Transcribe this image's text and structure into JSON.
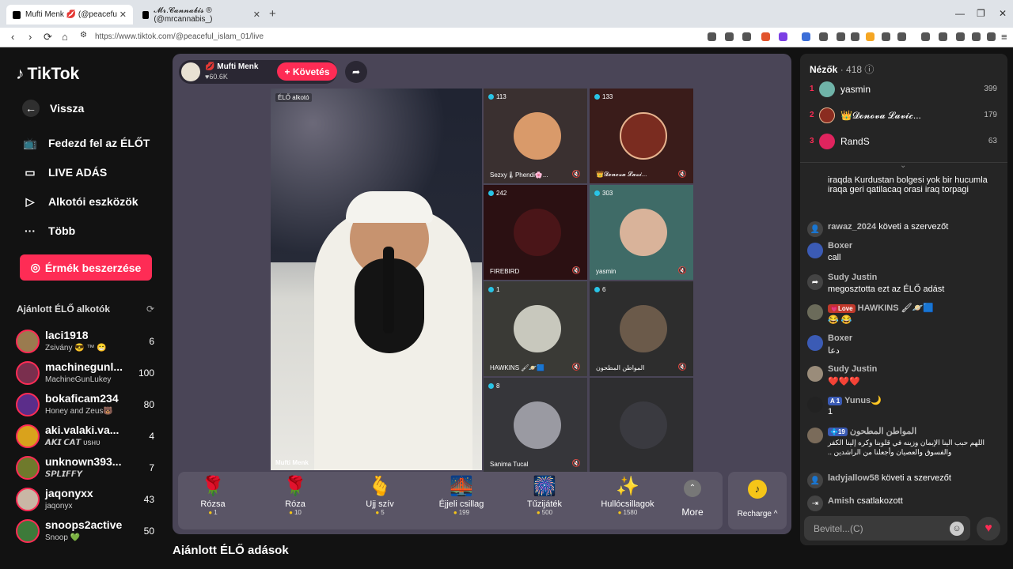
{
  "browser": {
    "tab1": "Mufti Menk 💋 (@peacefu",
    "tab2": "𝓜𝓻.𝓒𝓪𝓷𝓷𝓪𝓫𝓲𝓼 ® (@mrcannabis_)",
    "url": "https://www.tiktok.com/@peaceful_islam_01/live"
  },
  "sidebar": {
    "logo": "TikTok",
    "back": "Vissza",
    "nav": [
      "Fedezd fel az ÉLŐT",
      "LIVE ADÁS",
      "Alkotói eszközök",
      "Több"
    ],
    "coins_button": "Érmék beszerzése",
    "rec_title": "Ajánlott ÉLŐ alkotók",
    "creators": [
      {
        "name": "laci1918",
        "sub": "Zsivány 😎 ™ 😁",
        "count": "6"
      },
      {
        "name": "machinegunl...",
        "sub": "MachineGunLukey",
        "count": "100"
      },
      {
        "name": "bokaficam234",
        "sub": "Honey and Zeus🐻",
        "count": "80"
      },
      {
        "name": "aki.valaki.va...",
        "sub": "𝘼𝙆𝙄 𝘾𝘼𝙏 ᴜsʜᴜ",
        "count": "4"
      },
      {
        "name": "unknown393...",
        "sub": "𝙎𝙋𝙇𝙄𝙁𝙁𝙔",
        "count": "7"
      },
      {
        "name": "jaqonyxx",
        "sub": "jaqonyx",
        "count": "43"
      },
      {
        "name": "snoops2active",
        "sub": "Snoop 💚",
        "count": "50"
      }
    ]
  },
  "host": {
    "name": "Mufti Menk",
    "likes": "♥60.6K",
    "follow": "+ Követés",
    "elo_tag": "ÉLŐ alkotó",
    "foot": "Mufti Menk"
  },
  "guests": [
    {
      "count": "113",
      "name": "Sezxy🌡Phendi🌸..."
    },
    {
      "count": "133",
      "name": "👑𝓓𝓸𝓷𝓸𝓿𝓪 𝓛𝓪𝓿𝓲..."
    },
    {
      "count": "242",
      "name": "FIREBIRD"
    },
    {
      "count": "303",
      "name": "yasmin"
    },
    {
      "count": "1",
      "name": "HAWKINS 🖌🪐🟦"
    },
    {
      "count": "6",
      "name": "المواطن المطحون"
    },
    {
      "count": "8",
      "name": "Sanima Tucal"
    }
  ],
  "gifts": [
    {
      "icon": "🌹",
      "name": "Rózsa",
      "price": "1"
    },
    {
      "icon": "🌹",
      "name": "Róza",
      "price": "10"
    },
    {
      "icon": "🫰",
      "name": "Ujj szív",
      "price": "5"
    },
    {
      "icon": "🌉",
      "name": "Éjjeli csillag",
      "price": "199"
    },
    {
      "icon": "🎆",
      "name": "Tűzijáték",
      "price": "500"
    },
    {
      "icon": "✨",
      "name": "Hullócsillagok",
      "price": "1580"
    }
  ],
  "more": "More",
  "recharge": "Recharge ^",
  "bottom_title": "Ajánlott ÉLŐ adások",
  "viewers": {
    "label": "Nézők",
    "count": "· 418",
    "list": [
      {
        "rank": "1",
        "name": "yasmin",
        "count": "399"
      },
      {
        "rank": "2",
        "name": "👑𝓓𝓸𝓷𝓸𝓿𝓪 𝓛𝓪𝓿𝓲𝓬...",
        "count": "179"
      },
      {
        "rank": "3",
        "name": "RandS",
        "count": "63"
      }
    ]
  },
  "chat": {
    "c0": "iraqda Kurdustan bolgesi yok bir hucumla iraqa geri qatilacaq orasi iraq torpagi",
    "c1_user": "rawaz_2024",
    "c1_text": "követi a szervezőt",
    "c2_user": "Boxer",
    "c2_text": "call",
    "c3_user": "Sudy Justin",
    "c3_text": "megosztotta ezt az ÉLŐ adást",
    "c4_badge": "💗Love",
    "c4_user": "HAWKINS 🖌🪐🟦",
    "c4_text": "😂 😂",
    "c5_user": "Boxer",
    "c5_text": "دعا",
    "c6_user": "Sudy Justin",
    "c6_text": "❤️❤️❤️",
    "c7_badge": "A 1",
    "c7_user": "Yunus🌙",
    "c7_text": "1",
    "c8_badge": "💠19",
    "c8_user": "المواطن المطحون",
    "c8_text": "اللهم حبب الينا الإيمان وزينه في قلوبنا وكره إلينا الكفر والفسوق والعصيان وأجعلنا من الراشدين ..",
    "c9_user": "ladyjallow58",
    "c9_text": "követi a szervezőt",
    "c10_user": "Amish",
    "c10_text": "csatlakozott"
  },
  "input_placeholder": "Bevitel...(C)"
}
